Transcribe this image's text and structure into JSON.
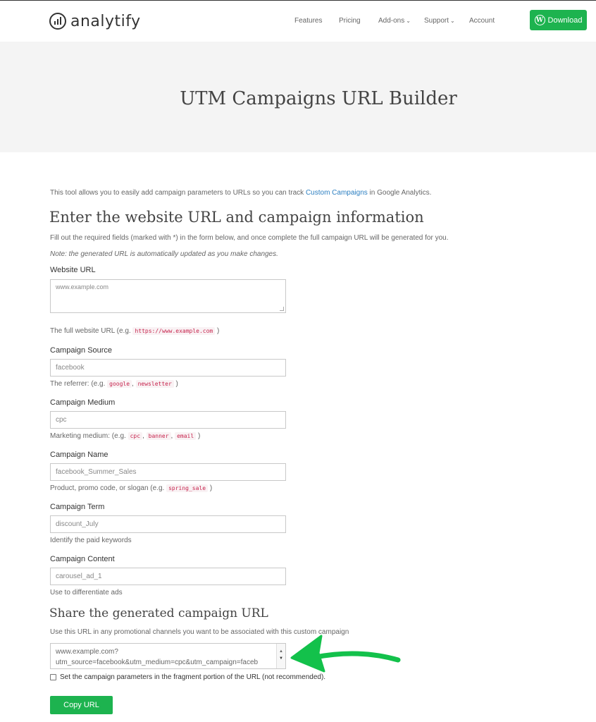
{
  "header": {
    "logo": "analytify",
    "nav": [
      "Features",
      "Pricing",
      "Add-ons",
      "Support",
      "Account"
    ],
    "download_label": "Download",
    "wp_glyph": "W"
  },
  "banner": {
    "title": "UTM Campaigns URL Builder"
  },
  "intro": {
    "before": "This tool allows you to easily add campaign parameters to URLs so you can track ",
    "link": "Custom Campaigns",
    "after": " in Google Analytics."
  },
  "form": {
    "heading": "Enter the website URL and campaign information",
    "description": "Fill out the required fields (marked with *) in the form below, and once complete the full campaign URL will be generated for you.",
    "note": "Note: the generated URL is automatically updated as you make changes.",
    "website": {
      "label": "Website URL",
      "placeholder": "www.example.com",
      "help_before": "The full website URL (e.g. ",
      "help_code": "https://www.example.com",
      "help_after": " )"
    },
    "source": {
      "label": "Campaign Source",
      "value": "facebook",
      "help_before": "The referrer: (e.g. ",
      "codes": [
        "google",
        "newsletter"
      ],
      "help_after": " )"
    },
    "medium": {
      "label": "Campaign Medium",
      "value": "cpc",
      "help_before": "Marketing medium: (e.g. ",
      "codes": [
        "cpc",
        "banner",
        "email"
      ],
      "help_after": " )"
    },
    "name": {
      "label": "Campaign Name",
      "value": "facebook_Summer_Sales",
      "help_before": "Product, promo code, or slogan (e.g. ",
      "help_code": "spring_sale",
      "help_after": " )"
    },
    "term": {
      "label": "Campaign Term",
      "value": "discount_July",
      "help": "Identify the paid keywords"
    },
    "content": {
      "label": "Campaign Content",
      "value": "carousel_ad_1",
      "help": "Use to differentiate ads"
    },
    "separator": ","
  },
  "share": {
    "heading": "Share the generated campaign URL",
    "description": "Use this URL in any promotional channels you want to be associated with this custom campaign",
    "url_line1": "www.example.com?",
    "url_line2": "utm_source=facebook&utm_medium=cpc&utm_campaign=faceb",
    "fragment_label": "Set the campaign parameters in the fragment portion of the URL (not recommended).",
    "copy_label": "Copy URL"
  },
  "colors": {
    "brand_green": "#1db34f",
    "arrow_green": "#13c14b",
    "link_blue": "#2c7fc1",
    "code_red": "#c7254e"
  }
}
